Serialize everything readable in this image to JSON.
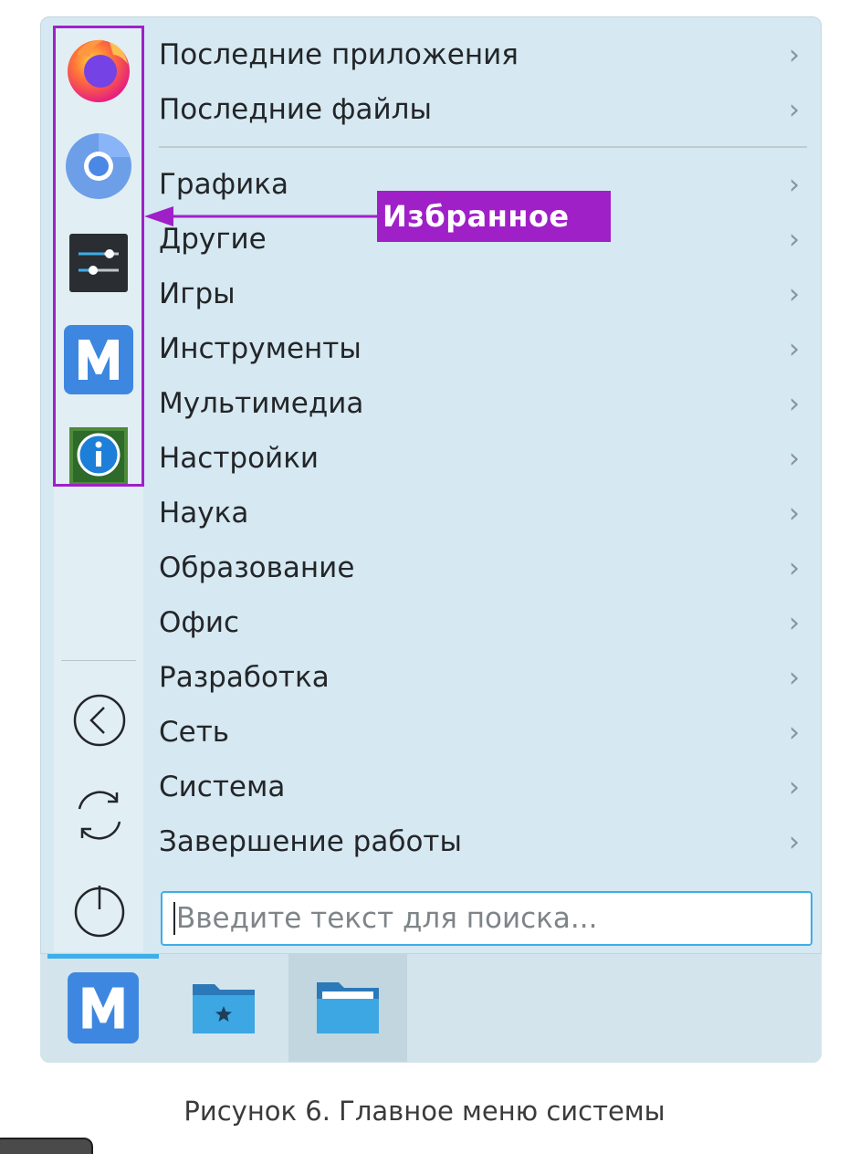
{
  "annotation": {
    "label": "Избранное"
  },
  "favorites": [
    {
      "name": "firefox",
      "icon": "firefox-icon"
    },
    {
      "name": "chromium",
      "icon": "chromium-icon"
    },
    {
      "name": "settings",
      "icon": "system-settings-icon"
    },
    {
      "name": "m-app",
      "icon": "m-app-icon"
    },
    {
      "name": "info-center",
      "icon": "info-center-icon"
    }
  ],
  "session": [
    {
      "name": "logout",
      "icon": "logout-icon"
    },
    {
      "name": "restart",
      "icon": "restart-icon"
    },
    {
      "name": "shutdown",
      "icon": "power-icon"
    }
  ],
  "categories": [
    {
      "label": "Последние приложения"
    },
    {
      "label": "Последние файлы"
    },
    {
      "label": "Графика"
    },
    {
      "label": "Другие"
    },
    {
      "label": "Игры"
    },
    {
      "label": "Инструменты"
    },
    {
      "label": "Мультимедиа"
    },
    {
      "label": "Настройки"
    },
    {
      "label": "Наука"
    },
    {
      "label": "Образование"
    },
    {
      "label": "Офис"
    },
    {
      "label": "Разработка"
    },
    {
      "label": "Сеть"
    },
    {
      "label": "Система"
    },
    {
      "label": "Завершение работы"
    }
  ],
  "chevron": "›",
  "search": {
    "placeholder": "Введите текст для поиска..."
  },
  "taskbar": [
    {
      "name": "menu-launcher",
      "icon": "m-app-icon",
      "active": true
    },
    {
      "name": "favorites-folder",
      "icon": "folder-star-icon"
    },
    {
      "name": "file-manager",
      "icon": "folder-icon"
    }
  ],
  "caption": "Рисунок 6. Главное меню системы",
  "colors": {
    "accent": "#3daee9",
    "annotation": "#a020c8",
    "menu_bg": "#d6e8f1"
  }
}
